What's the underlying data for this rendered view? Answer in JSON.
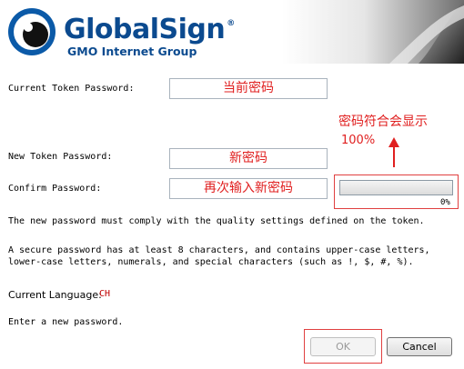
{
  "header": {
    "brand_name": "GlobalSign",
    "brand_reg": "®",
    "brand_subtitle": "GMO Internet Group"
  },
  "form": {
    "current_password_label": "Current Token Password:",
    "current_password_value": "当前密码",
    "new_password_label": "New Token Password:",
    "new_password_value": "新密码",
    "confirm_password_label": "Confirm Password:",
    "confirm_password_value": "再次输入新密码"
  },
  "quality": {
    "percent_label": "0%",
    "level": 0
  },
  "annotation": {
    "line1": "密码符合会显示",
    "line2": "100%",
    "color": "#e02020"
  },
  "info": {
    "quality_notice": "The new password must comply with the quality settings defined on the token.",
    "secure_line1": "A secure password has at least 8 characters, and contains upper-case letters,",
    "secure_line2": "lower-case letters, numerals, and special characters (such as !, $, #, %).",
    "language_label": "Current Language:",
    "language_value": "CH",
    "status": "Enter a new password."
  },
  "buttons": {
    "ok_label": "OK",
    "cancel_label": "Cancel"
  },
  "watermark": ""
}
